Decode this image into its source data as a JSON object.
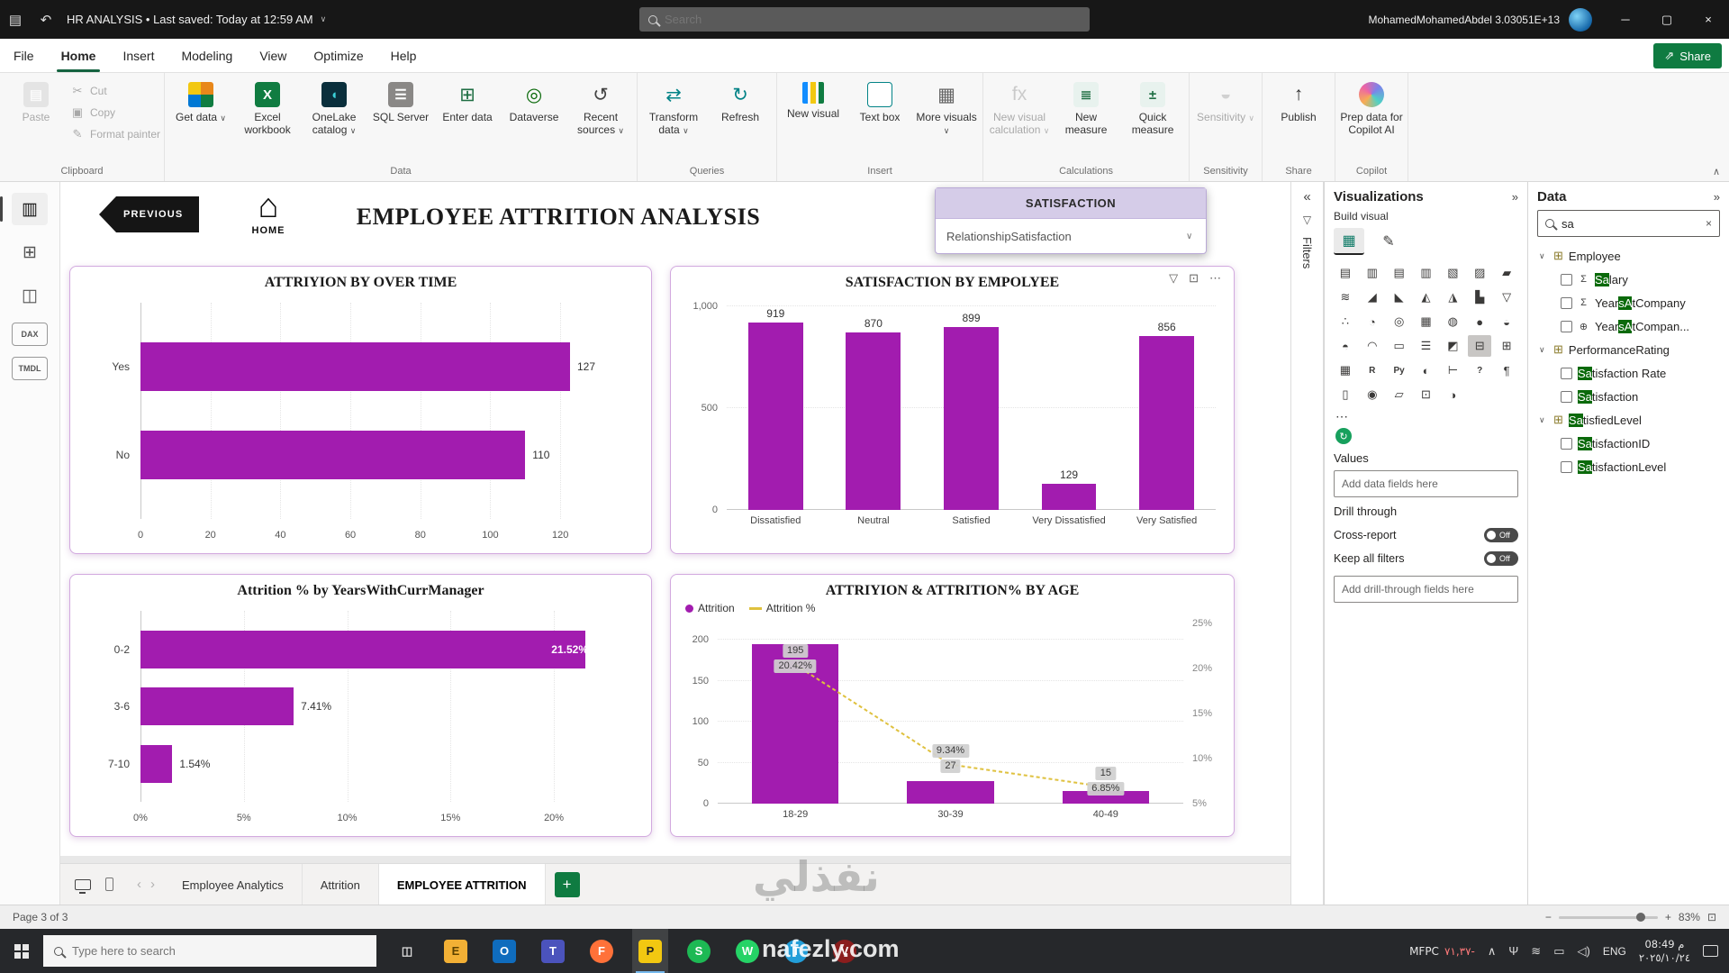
{
  "titlebar": {
    "save_icon": "▤",
    "undo_icon": "↶",
    "doc_title": "HR ANALYSIS • Last saved: Today at 12:59 AM",
    "title_chevron": "∨",
    "search_placeholder": "Search",
    "user": "MohamedMohamedAbdel 3.03051E+13",
    "window": {
      "minimize": "─",
      "maximize": "▢",
      "close": "×"
    }
  },
  "menubar": {
    "items": [
      "File",
      "Home",
      "Insert",
      "Modeling",
      "View",
      "Optimize",
      "Help"
    ],
    "active_index": 1,
    "share_label": "Share",
    "share_icon": "⇗"
  },
  "ribbon": {
    "collapse_icon": "∧",
    "groups": [
      {
        "label": "Clipboard",
        "items": [
          {
            "label": "Paste",
            "glyph": "▤",
            "bg": "#c9c9c9",
            "fg": "#fff",
            "disabled": true
          },
          {
            "label": "Cut",
            "small": true,
            "glyph": "✂",
            "disabled": true
          },
          {
            "label": "Copy",
            "small": true,
            "glyph": "▣",
            "disabled": true
          },
          {
            "label": "Format painter",
            "small": true,
            "glyph": "✎",
            "disabled": true
          }
        ]
      },
      {
        "label": "Data",
        "items": [
          {
            "label": "Get data",
            "cls": "ic-multigrid",
            "dropdown": true
          },
          {
            "label": "Excel workbook",
            "glyph": "X",
            "bg": "#107C41",
            "fg": "#fff"
          },
          {
            "label": "OneLake catalog",
            "glyph": "◖",
            "bg": "#0a2f3c",
            "fg": "#3bd0d8",
            "dropdown": true
          },
          {
            "label": "SQL Server",
            "glyph": "☰",
            "bg": "#8a8886",
            "fg": "#fff"
          },
          {
            "label": "Enter data",
            "glyph": "⊞",
            "fg": "#1f6e43",
            "glyphonly": true
          },
          {
            "label": "Dataverse",
            "glyph": "◎",
            "fg": "#0b6a0b",
            "glyphonly": true
          },
          {
            "label": "Recent sources",
            "glyph": "↺",
            "fg": "#444",
            "glyphonly": true,
            "dropdown": true
          }
        ]
      },
      {
        "label": "Queries",
        "items": [
          {
            "label": "Transform data",
            "glyph": "⇄",
            "fg": "#038387",
            "glyphonly": true,
            "dropdown": true
          },
          {
            "label": "Refresh",
            "glyph": "↻",
            "fg": "#038387",
            "glyphonly": true
          }
        ]
      },
      {
        "label": "Insert",
        "items": [
          {
            "label": "New visual",
            "cls": "ic-bars3"
          },
          {
            "label": "Text box",
            "glyph": "A",
            "cls": "ic-abox"
          },
          {
            "label": "More visuals",
            "glyph": "▦",
            "fg": "#666",
            "glyphonly": true,
            "dropdown": true
          }
        ]
      },
      {
        "label": "Calculations",
        "items": [
          {
            "label": "New visual calculation",
            "glyph": "fx",
            "fg": "#888",
            "glyphonly": true,
            "disabled": true,
            "dropdown": true
          },
          {
            "label": "New measure",
            "glyph": "≣",
            "bg": "#e8f2ee",
            "fg": "#1f6e43"
          },
          {
            "label": "Quick measure",
            "glyph": "±",
            "bg": "#e8f2ee",
            "fg": "#1f6e43"
          }
        ]
      },
      {
        "label": "Sensitivity",
        "items": [
          {
            "label": "Sensitivity",
            "glyph": "◒",
            "fg": "#9a9a9a",
            "glyphonly": true,
            "disabled": true,
            "dropdown": true
          }
        ]
      },
      {
        "label": "Share",
        "items": [
          {
            "label": "Publish",
            "glyph": "↑",
            "fg": "#333",
            "glyphonly": true
          }
        ]
      },
      {
        "label": "Copilot",
        "items": [
          {
            "label": "Prep data for Copilot AI",
            "cls": "ic-copilot"
          }
        ]
      }
    ]
  },
  "rail": {
    "items": [
      {
        "name": "report-view",
        "glyph": "▥",
        "text": false
      },
      {
        "name": "table-view",
        "glyph": "⊞",
        "text": false
      },
      {
        "name": "model-view",
        "glyph": "◫",
        "text": false
      },
      {
        "name": "dax-query-view",
        "glyph": "DAX",
        "text": true
      },
      {
        "name": "tmdl-view",
        "glyph": "TMDL",
        "text": true
      }
    ],
    "active_index": 0
  },
  "report": {
    "previous_label": "PREVIOUS",
    "home_icon": "⌂",
    "home_label": "HOME",
    "title": "EMPLOYEE ATTRITION ANALYSIS",
    "slicer": {
      "header": "SATISFACTION",
      "value": "RelationshipSatisfaction",
      "chevron": "∨"
    },
    "hover_icons": {
      "filter": "▽",
      "focus": "⊡",
      "more": "⋯"
    }
  },
  "chart_data": [
    {
      "type": "bar",
      "orientation": "horizontal",
      "title": "ATTRIYION BY OVER TIME",
      "categories": [
        "Yes",
        "No"
      ],
      "values": [
        127,
        110
      ],
      "value_labels": [
        "127",
        "110"
      ],
      "xlim": [
        0,
        130
      ],
      "xticks": [
        0,
        20,
        40,
        60,
        80,
        100,
        120
      ],
      "xtick_labels": [
        "0",
        "20",
        "40",
        "60",
        "80",
        "100",
        "120"
      ],
      "bar_color": "#a21caf"
    },
    {
      "type": "bar",
      "orientation": "vertical",
      "title": "SATISFACTION BY EMPOLYEE",
      "categories": [
        "Dissatisfied",
        "Neutral",
        "Satisfied",
        "Very Dissatisfied",
        "Very Satisfied"
      ],
      "values": [
        919,
        870,
        899,
        129,
        856
      ],
      "value_labels": [
        "919",
        "870",
        "899",
        "129",
        "856"
      ],
      "ylim": [
        0,
        1000
      ],
      "yticks": [
        0,
        500,
        1000
      ],
      "ytick_labels": [
        "0",
        "500",
        "1,000"
      ],
      "bar_color": "#a21caf"
    },
    {
      "type": "bar",
      "orientation": "horizontal",
      "title": "Attrition % by YearsWithCurrManager",
      "categories": [
        "0-2",
        "3-6",
        "7-10"
      ],
      "values": [
        21.52,
        7.41,
        1.54
      ],
      "value_labels": [
        "21.52%",
        "7.41%",
        "1.54%"
      ],
      "label_inside": [
        true,
        false,
        false
      ],
      "xlim": [
        0,
        22
      ],
      "xticks": [
        0,
        5,
        10,
        15,
        20
      ],
      "xtick_labels": [
        "0%",
        "5%",
        "10%",
        "15%",
        "20%"
      ],
      "bar_color": "#a21caf"
    },
    {
      "type": "combo",
      "title": "ATTRIYION & ATTRITION% BY AGE",
      "categories": [
        "18-29",
        "30-39",
        "40-49"
      ],
      "series": [
        {
          "name": "Attrition",
          "type": "bar",
          "values": [
            195,
            27,
            15
          ],
          "color": "#a21caf"
        },
        {
          "name": "Attrition %",
          "type": "line",
          "values": [
            20.42,
            9.34,
            6.85
          ],
          "color": "#dfc13e"
        }
      ],
      "ylim_left": [
        0,
        220
      ],
      "yticks_left": [
        0,
        50,
        100,
        150,
        200
      ],
      "ylim_right": [
        5,
        25
      ],
      "yticks_right_values": [
        25,
        20,
        15,
        10,
        5
      ],
      "yticks_right_labels": [
        "25%",
        "20%",
        "15%",
        "10%",
        "5%"
      ],
      "point_labels": [
        [
          "195",
          "20.42%"
        ],
        [
          "9.34%",
          "27"
        ],
        [
          "15",
          "6.85%"
        ]
      ]
    }
  ],
  "filters": {
    "expand_icon": "«",
    "funnel_icon": "▽",
    "label": "Filters"
  },
  "viz_panel": {
    "title": "Visualizations",
    "collapse_icon": "»",
    "build_label": "Build visual",
    "tabs": [
      {
        "name": "build-visual-tab",
        "glyph": "▦"
      },
      {
        "name": "format-visual-tab",
        "glyph": "✎"
      }
    ],
    "icons": [
      {
        "n": "stacked-bar-chart-icon",
        "g": "▤"
      },
      {
        "n": "stacked-column-chart-icon",
        "g": "▥"
      },
      {
        "n": "clustered-bar-chart-icon",
        "g": "▤"
      },
      {
        "n": "clustered-column-chart-icon",
        "g": "▥"
      },
      {
        "n": "100-stacked-bar-chart-icon",
        "g": "▧"
      },
      {
        "n": "100-stacked-column-chart-icon",
        "g": "▨"
      },
      {
        "n": "ribbon-chart-icon",
        "g": "▰"
      },
      {
        "n": "line-chart-icon",
        "g": "≋"
      },
      {
        "n": "area-chart-icon",
        "g": "◢"
      },
      {
        "n": "stacked-area-chart-icon",
        "g": "◣"
      },
      {
        "n": "line-stacked-column-chart-icon",
        "g": "◭"
      },
      {
        "n": "line-clustered-column-chart-icon",
        "g": "◮"
      },
      {
        "n": "waterfall-chart-icon",
        "g": "▙"
      },
      {
        "n": "funnel-chart-icon",
        "g": "▽"
      },
      {
        "n": "scatter-chart-icon",
        "g": "∴"
      },
      {
        "n": "pie-chart-icon",
        "g": "◔"
      },
      {
        "n": "donut-chart-icon",
        "g": "◎"
      },
      {
        "n": "treemap-icon",
        "g": "▦"
      },
      {
        "n": "map-icon",
        "g": "◍"
      },
      {
        "n": "filled-map-icon",
        "g": "●"
      },
      {
        "n": "shape-map-icon",
        "g": "◒"
      },
      {
        "n": "azure-map-icon",
        "g": "◓"
      },
      {
        "n": "gauge-icon",
        "g": "◠"
      },
      {
        "n": "card-icon",
        "g": "▭"
      },
      {
        "n": "multirow-card-icon",
        "g": "☰"
      },
      {
        "n": "kpi-icon",
        "g": "◩"
      },
      {
        "n": "slicer-icon",
        "g": "⊟"
      },
      {
        "n": "table-icon",
        "g": "⊞"
      },
      {
        "n": "matrix-icon",
        "g": "▦"
      },
      {
        "n": "r-script-icon",
        "g": "R",
        "txt": true
      },
      {
        "n": "python-visual-icon",
        "g": "Py",
        "txt": true
      },
      {
        "n": "key-influencers-icon",
        "g": "◐"
      },
      {
        "n": "decomposition-tree-icon",
        "g": "⊢"
      },
      {
        "n": "qa-icon",
        "g": "?",
        "txt": true
      },
      {
        "n": "smart-narrative-icon",
        "g": "¶"
      },
      {
        "n": "paginated-report-icon",
        "g": "▯"
      },
      {
        "n": "arcgis-map-icon",
        "g": "◉"
      },
      {
        "n": "power-apps-icon",
        "g": "▱"
      },
      {
        "n": "power-automate-icon",
        "g": "⊡"
      },
      {
        "n": "metrics-icon",
        "g": "◑"
      }
    ],
    "selected_icon_index": 26,
    "more_ic": "⋯",
    "custom_visual_glyph": "↻",
    "values_label": "Values",
    "add_fields_placeholder": "Add data fields here",
    "drill_label": "Drill through",
    "toggles": [
      {
        "label": "Cross-report",
        "state": "Off"
      },
      {
        "label": "Keep all filters",
        "state": "Off"
      }
    ],
    "add_drill_placeholder": "Add drill-through fields here"
  },
  "data_panel": {
    "title": "Data",
    "collapse_icon": "»",
    "search_value": "sa",
    "clear_icon": "×",
    "tables": [
      {
        "name_parts": [
          {
            "t": "Employee",
            "h": false
          }
        ],
        "fields": [
          {
            "parts": [
              {
                "t": "Sa",
                "h": true
              },
              {
                "t": "lary",
                "h": false
              }
            ],
            "icon": "sigma"
          },
          {
            "parts": [
              {
                "t": "Year",
                "h": false
              },
              {
                "t": "sA",
                "h": true
              },
              {
                "t": "tCompany",
                "h": false
              }
            ],
            "icon": "sigma"
          },
          {
            "parts": [
              {
                "t": "Year",
                "h": false
              },
              {
                "t": "sA",
                "h": true
              },
              {
                "t": "tCompan...",
                "h": false
              }
            ],
            "icon": "globe"
          }
        ]
      },
      {
        "name_parts": [
          {
            "t": "PerformanceRating",
            "h": false
          }
        ],
        "fields": [
          {
            "parts": [
              {
                "t": "Sa",
                "h": true
              },
              {
                "t": "tisfaction Rate",
                "h": false
              }
            ],
            "icon": "none"
          },
          {
            "parts": [
              {
                "t": "Sa",
                "h": true
              },
              {
                "t": "tisfaction",
                "h": false
              }
            ],
            "icon": "none"
          }
        ]
      },
      {
        "name_parts": [
          {
            "t": "Sa",
            "h": true
          },
          {
            "t": "tisfiedLevel",
            "h": false
          }
        ],
        "fields": [
          {
            "parts": [
              {
                "t": "Sa",
                "h": true
              },
              {
                "t": "tisfactionID",
                "h": false
              }
            ],
            "icon": "none"
          },
          {
            "parts": [
              {
                "t": "Sa",
                "h": true
              },
              {
                "t": "tisfactionLevel",
                "h": false
              }
            ],
            "icon": "none"
          }
        ]
      }
    ]
  },
  "tabs": {
    "pages": [
      "Employee Analytics",
      "Attrition",
      "EMPLOYEE ATTRITION"
    ],
    "active_index": 2,
    "add_icon": "+",
    "back_icon": "‹",
    "forward_icon": "›"
  },
  "statusbar": {
    "page_indicator": "Page 3 of 3",
    "zoom_out": "−",
    "zoom_in": "+",
    "zoom_level": "83%",
    "fit_icon": "⊡"
  },
  "taskbar": {
    "search_placeholder": "Type here to search",
    "apps": [
      {
        "name": "task-view-icon",
        "t": "◫",
        "bg": "transparent",
        "fg": "#ddd",
        "circle": false
      },
      {
        "name": "file-explorer-icon",
        "t": "E",
        "bg": "#f2b035",
        "fg": "#5e4200",
        "circle": false
      },
      {
        "name": "outlook-icon",
        "t": "O",
        "bg": "#0f6cbd",
        "fg": "#fff",
        "circle": false
      },
      {
        "name": "teams-icon",
        "t": "T",
        "bg": "#4b53bc",
        "fg": "#fff",
        "circle": false
      },
      {
        "name": "firefox-icon",
        "t": "F",
        "bg": "#ff7139",
        "fg": "#fff",
        "circle": true
      },
      {
        "name": "power-bi-icon",
        "t": "P",
        "bg": "#f2c811",
        "fg": "#222",
        "circle": false,
        "active": true
      },
      {
        "name": "spotify-icon",
        "t": "S",
        "bg": "#1db954",
        "fg": "#fff",
        "circle": true
      },
      {
        "name": "whatsapp-icon",
        "t": "W",
        "bg": "#25d366",
        "fg": "#fff",
        "circle": true
      },
      {
        "name": "telegram-icon",
        "t": "T",
        "bg": "#229ed9",
        "fg": "#fff",
        "circle": true
      },
      {
        "name": "media-app-icon",
        "t": "V",
        "bg": "#8b1d1d",
        "fg": "#fff",
        "circle": true
      }
    ],
    "tray": {
      "ticker_symbol": "MFPC",
      "ticker_change": "٧١,٣٧-",
      "hidden_icon": "∧",
      "mic_icon": "Ψ",
      "network_icon": "≋",
      "battery_icon": "▭",
      "volume_icon": "◁)",
      "language": "ENG",
      "time": "08:49 م",
      "date": "٢٠٢٥/١٠/٢٤",
      "notif_name": "notification-icon"
    }
  },
  "watermark": {
    "arabic": "نفذلي",
    "latin": "nafezly.com"
  }
}
